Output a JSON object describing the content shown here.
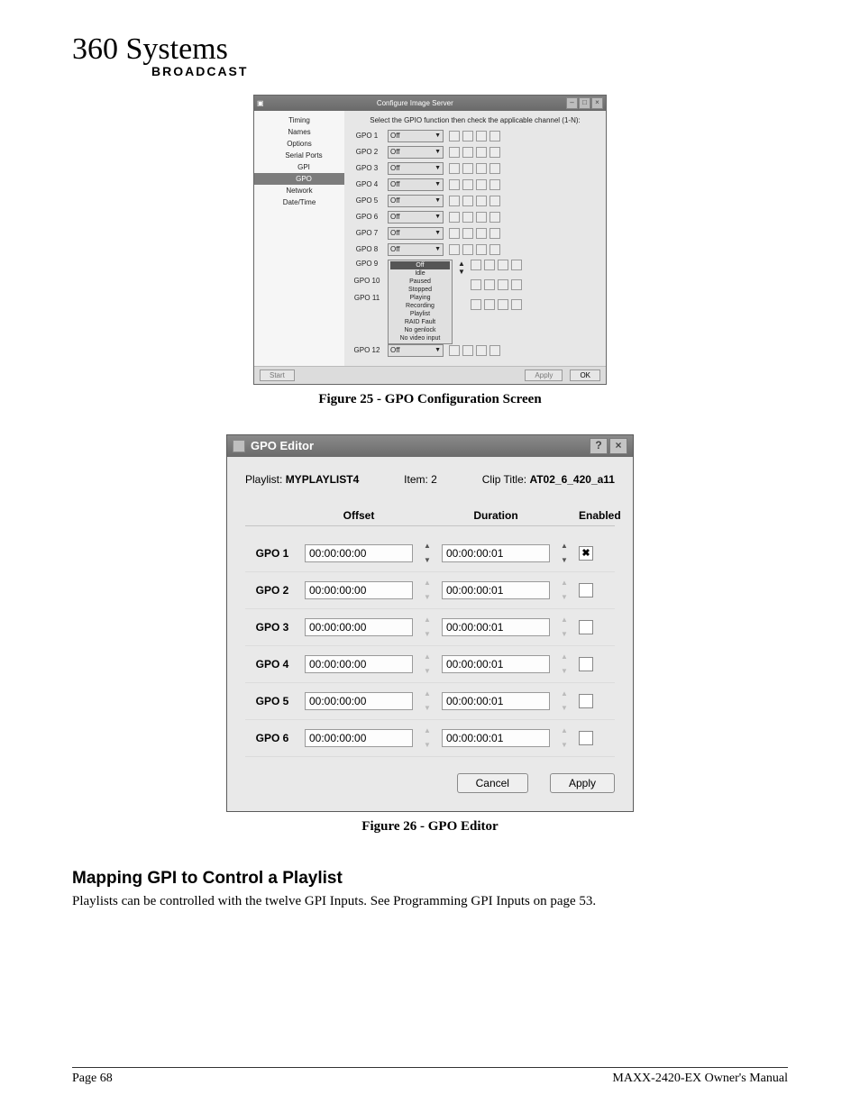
{
  "logo": {
    "brand": "360 Systems",
    "sub": "BROADCAST"
  },
  "figure1": {
    "window_title": "Configure Image Server",
    "instruction": "Select the GPIO function then check the applicable channel (1-N):",
    "sidebar": [
      {
        "label": "Timing",
        "selected": false,
        "indent": false
      },
      {
        "label": "Names",
        "selected": false,
        "indent": false
      },
      {
        "label": "Options",
        "selected": false,
        "indent": false
      },
      {
        "label": "Serial Ports",
        "selected": false,
        "indent": true
      },
      {
        "label": "GPI",
        "selected": false,
        "indent": true
      },
      {
        "label": "GPO",
        "selected": true,
        "indent": true
      },
      {
        "label": "Network",
        "selected": false,
        "indent": false
      },
      {
        "label": "Date/Time",
        "selected": false,
        "indent": false
      }
    ],
    "rows": [
      {
        "label": "GPO 1",
        "value": "Off",
        "type": "select"
      },
      {
        "label": "GPO 2",
        "value": "Off",
        "type": "select"
      },
      {
        "label": "GPO 3",
        "value": "Off",
        "type": "select"
      },
      {
        "label": "GPO 4",
        "value": "Off",
        "type": "select"
      },
      {
        "label": "GPO 5",
        "value": "Off",
        "type": "select"
      },
      {
        "label": "GPO 6",
        "value": "Off",
        "type": "select"
      },
      {
        "label": "GPO 7",
        "value": "Off",
        "type": "select"
      },
      {
        "label": "GPO 8",
        "value": "Off",
        "type": "select"
      }
    ],
    "listbox_rows": [
      {
        "label": "GPO 9",
        "options": [
          "Off",
          "Idle",
          "Paused",
          "Stopped",
          "Playing",
          "Recording",
          "Playlist",
          "RAID Fault",
          "No genlock",
          "No video input"
        ]
      },
      {
        "label": "GPO 10",
        "options": []
      },
      {
        "label": "GPO 11",
        "options": []
      }
    ],
    "final_row": {
      "label": "GPO 12",
      "value": "Off"
    },
    "buttons": {
      "start": "Start",
      "apply": "Apply",
      "ok": "OK"
    },
    "caption": "Figure 25 - GPO Configuration Screen"
  },
  "figure2": {
    "window_title": "GPO Editor",
    "playlist_label": "Playlist:",
    "playlist_value": "MYPLAYLIST4",
    "item_label": "Item:",
    "item_value": "2",
    "clip_label": "Clip Title:",
    "clip_value": "AT02_6_420_a11",
    "headers": {
      "offset": "Offset",
      "duration": "Duration",
      "enabled": "Enabled"
    },
    "rows": [
      {
        "name": "GPO 1",
        "offset": "00:00:00:00",
        "duration": "00:00:00:01",
        "enabled": true,
        "spin_active": true
      },
      {
        "name": "GPO 2",
        "offset": "00:00:00:00",
        "duration": "00:00:00:01",
        "enabled": false,
        "spin_active": false
      },
      {
        "name": "GPO 3",
        "offset": "00:00:00:00",
        "duration": "00:00:00:01",
        "enabled": false,
        "spin_active": false
      },
      {
        "name": "GPO 4",
        "offset": "00:00:00:00",
        "duration": "00:00:00:01",
        "enabled": false,
        "spin_active": false
      },
      {
        "name": "GPO 5",
        "offset": "00:00:00:00",
        "duration": "00:00:00:01",
        "enabled": false,
        "spin_active": false
      },
      {
        "name": "GPO 6",
        "offset": "00:00:00:00",
        "duration": "00:00:00:01",
        "enabled": false,
        "spin_active": false
      }
    ],
    "buttons": {
      "cancel": "Cancel",
      "apply": "Apply"
    },
    "caption": "Figure 26 - GPO Editor"
  },
  "section": {
    "heading": "Mapping GPI to Control a Playlist",
    "body": "Playlists can be controlled with the twelve GPI Inputs. See Programming GPI Inputs on page 53."
  },
  "footer": {
    "left": "Page 68",
    "right": "MAXX-2420-EX Owner's Manual"
  }
}
